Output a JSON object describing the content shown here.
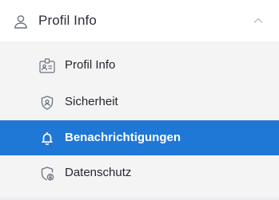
{
  "section": {
    "title": "Profil Info",
    "icon": "user-icon",
    "expanded": true,
    "collapse_icon": "chevron-up-icon"
  },
  "items": [
    {
      "label": "Profil Info",
      "icon": "id-badge-icon",
      "active": false
    },
    {
      "label": "Sicherheit",
      "icon": "shield-icon",
      "active": false
    },
    {
      "label": "Benachrichtigungen",
      "icon": "bell-icon",
      "active": true
    },
    {
      "label": "Datenschutz",
      "icon": "privacy-shield-lock-icon",
      "active": false
    }
  ],
  "colors": {
    "accent": "#1f77d6",
    "panel_bg": "#f4f4f5",
    "header_bg": "#ffffff",
    "text": "#24272e",
    "icon": "#6b7280"
  }
}
